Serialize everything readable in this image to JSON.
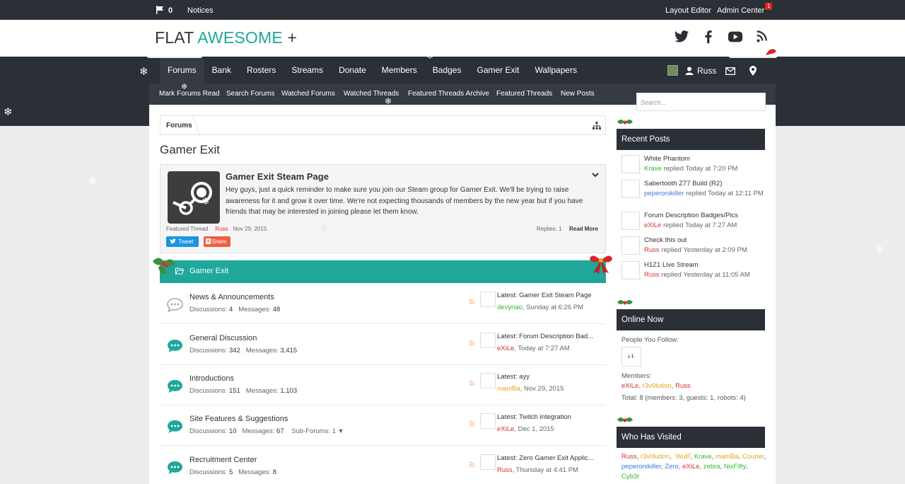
{
  "topbar": {
    "notice_count": "0",
    "notices_label": "Notices",
    "layout_editor": "Layout Editor",
    "admin_center": "Admin Center",
    "admin_badge": "1"
  },
  "logo": {
    "part1": "FLAT ",
    "part2": "AWESOME",
    "part3": " +"
  },
  "nav": {
    "tabs": [
      "Forums",
      "Bank",
      "Rosters",
      "Streams",
      "Donate",
      "Members",
      "Badges",
      "Gamer Exit",
      "Wallpapers"
    ],
    "user": "Russ",
    "subnav": [
      "Mark Forums Read",
      "Search Forums",
      "Watched Forums",
      "Watched Threads",
      "Featured Threads Archive",
      "Featured Threads",
      "New Posts"
    ]
  },
  "search": {
    "placeholder": "Search..."
  },
  "breadcrumb": {
    "crumb": "Forums"
  },
  "page": {
    "title": "Gamer Exit"
  },
  "featured": {
    "title": "Gamer Exit Steam Page",
    "body": "Hey guys, just a quick reminder to make sure you join our Steam group for Gamer Exit. We'll be trying to raise awareness for it and grow it over time. We're not expecting thousands of members by the new year but if you have friends that may be interested in joining please let them know.",
    "label": "Featured Thread",
    "author": "Russ",
    "date": "Nov 29, 2015",
    "replies": "Replies: 1",
    "read_more": "Read More",
    "tweet": "Tweet",
    "share": "Share"
  },
  "category": {
    "title": "Gamer Exit"
  },
  "forums": [
    {
      "name": "News & Announcements",
      "discussions": "4",
      "messages": "48",
      "sub": "",
      "latest": "Latest: Gamer Exit Steam Page",
      "user": "devynao",
      "user_color": "#2eb82e",
      "when": "Sunday at 6:26 PM",
      "icon_color": "#a8a8a8"
    },
    {
      "name": "General Discussion",
      "discussions": "342",
      "messages": "3,415",
      "sub": "",
      "latest": "Latest: Forum Description Bad...",
      "user": "eXiLe",
      "user_color": "#d23232",
      "when": "Today at 7:27 AM",
      "icon_color": "#1fa79a"
    },
    {
      "name": "Introductions",
      "discussions": "151",
      "messages": "1,103",
      "sub": "",
      "latest": "Latest: ayy",
      "user": "mamBa",
      "user_color": "#e8a317",
      "when": "Nov 29, 2015",
      "icon_color": "#1fa79a"
    },
    {
      "name": "Site Features & Suggestions",
      "discussions": "10",
      "messages": "67",
      "sub": "Sub-Forums: 1",
      "latest": "Latest: Twitch integration",
      "user": "eXiLe",
      "user_color": "#d23232",
      "when": "Dec 1, 2015",
      "icon_color": "#1fa79a"
    },
    {
      "name": "Recruitment Center",
      "discussions": "5",
      "messages": "8",
      "sub": "",
      "latest": "Latest: Zero Gamer Exit Applic...",
      "user": "Russ",
      "user_color": "#d23232",
      "when": "Thursday at 4:41 PM",
      "icon_color": "#1fa79a"
    }
  ],
  "labels": {
    "discussions": "Discussions:",
    "messages": "Messages:"
  },
  "sidebar": {
    "recent_title": "Recent Posts",
    "recent": [
      {
        "title": "White Phantom",
        "user": "Krave",
        "user_color": "#2eb82e",
        "action": " replied Today at 7:20 PM"
      },
      {
        "title": "Sabertooth Z77 Build (R2)",
        "user": "peperonikiller",
        "user_color": "#3b7ad9",
        "action": " replied Today at 12:11 PM"
      },
      {
        "title": "Forum Description Badges/Pics",
        "user": "eXiLe",
        "user_color": "#d23232",
        "action": " replied Today at 7:27 AM"
      },
      {
        "title": "Check this out",
        "user": "Russ",
        "user_color": "#d23232",
        "action": " replied Yesterday at 2:09 PM"
      },
      {
        "title": "H1Z1 Live Stream",
        "user": "Russ",
        "user_color": "#d23232",
        "action": " replied Yesterday at 11:05 AM"
      }
    ],
    "online_title": "Online Now",
    "follow_label": "People You Follow:",
    "members_label": "Members:",
    "online_members": [
      {
        "name": "eXiLe",
        "color": "#d23232"
      },
      {
        "name": "r3v0lution",
        "color": "#e8a317"
      },
      {
        "name": "Russ",
        "color": "#d23232"
      }
    ],
    "total": "Total: 8 (members: 3, guests: 1, robots: 4)",
    "visited_title": "Who Has Visited",
    "visited": [
      {
        "name": "Russ",
        "color": "#d23232"
      },
      {
        "name": "r3v0lution",
        "color": "#e8a317"
      },
      {
        "name": "`WulF",
        "color": "#e8a317"
      },
      {
        "name": "Krave",
        "color": "#2eb82e"
      },
      {
        "name": "mamBa",
        "color": "#e8a317"
      },
      {
        "name": "Courier",
        "color": "#e8a317"
      },
      {
        "name": "peperonikiller",
        "color": "#3b7ad9"
      },
      {
        "name": "Zero",
        "color": "#3b7ad9"
      },
      {
        "name": "eXiLe",
        "color": "#d23232"
      },
      {
        "name": "zebra",
        "color": "#2eb82e"
      },
      {
        "name": "NixFifty",
        "color": "#2eb82e"
      },
      {
        "name": "Cyb3r",
        "color": "#2eb82e"
      }
    ]
  },
  "colors": {
    "accent": "#1fa79a",
    "dark": "#2b2f36"
  }
}
